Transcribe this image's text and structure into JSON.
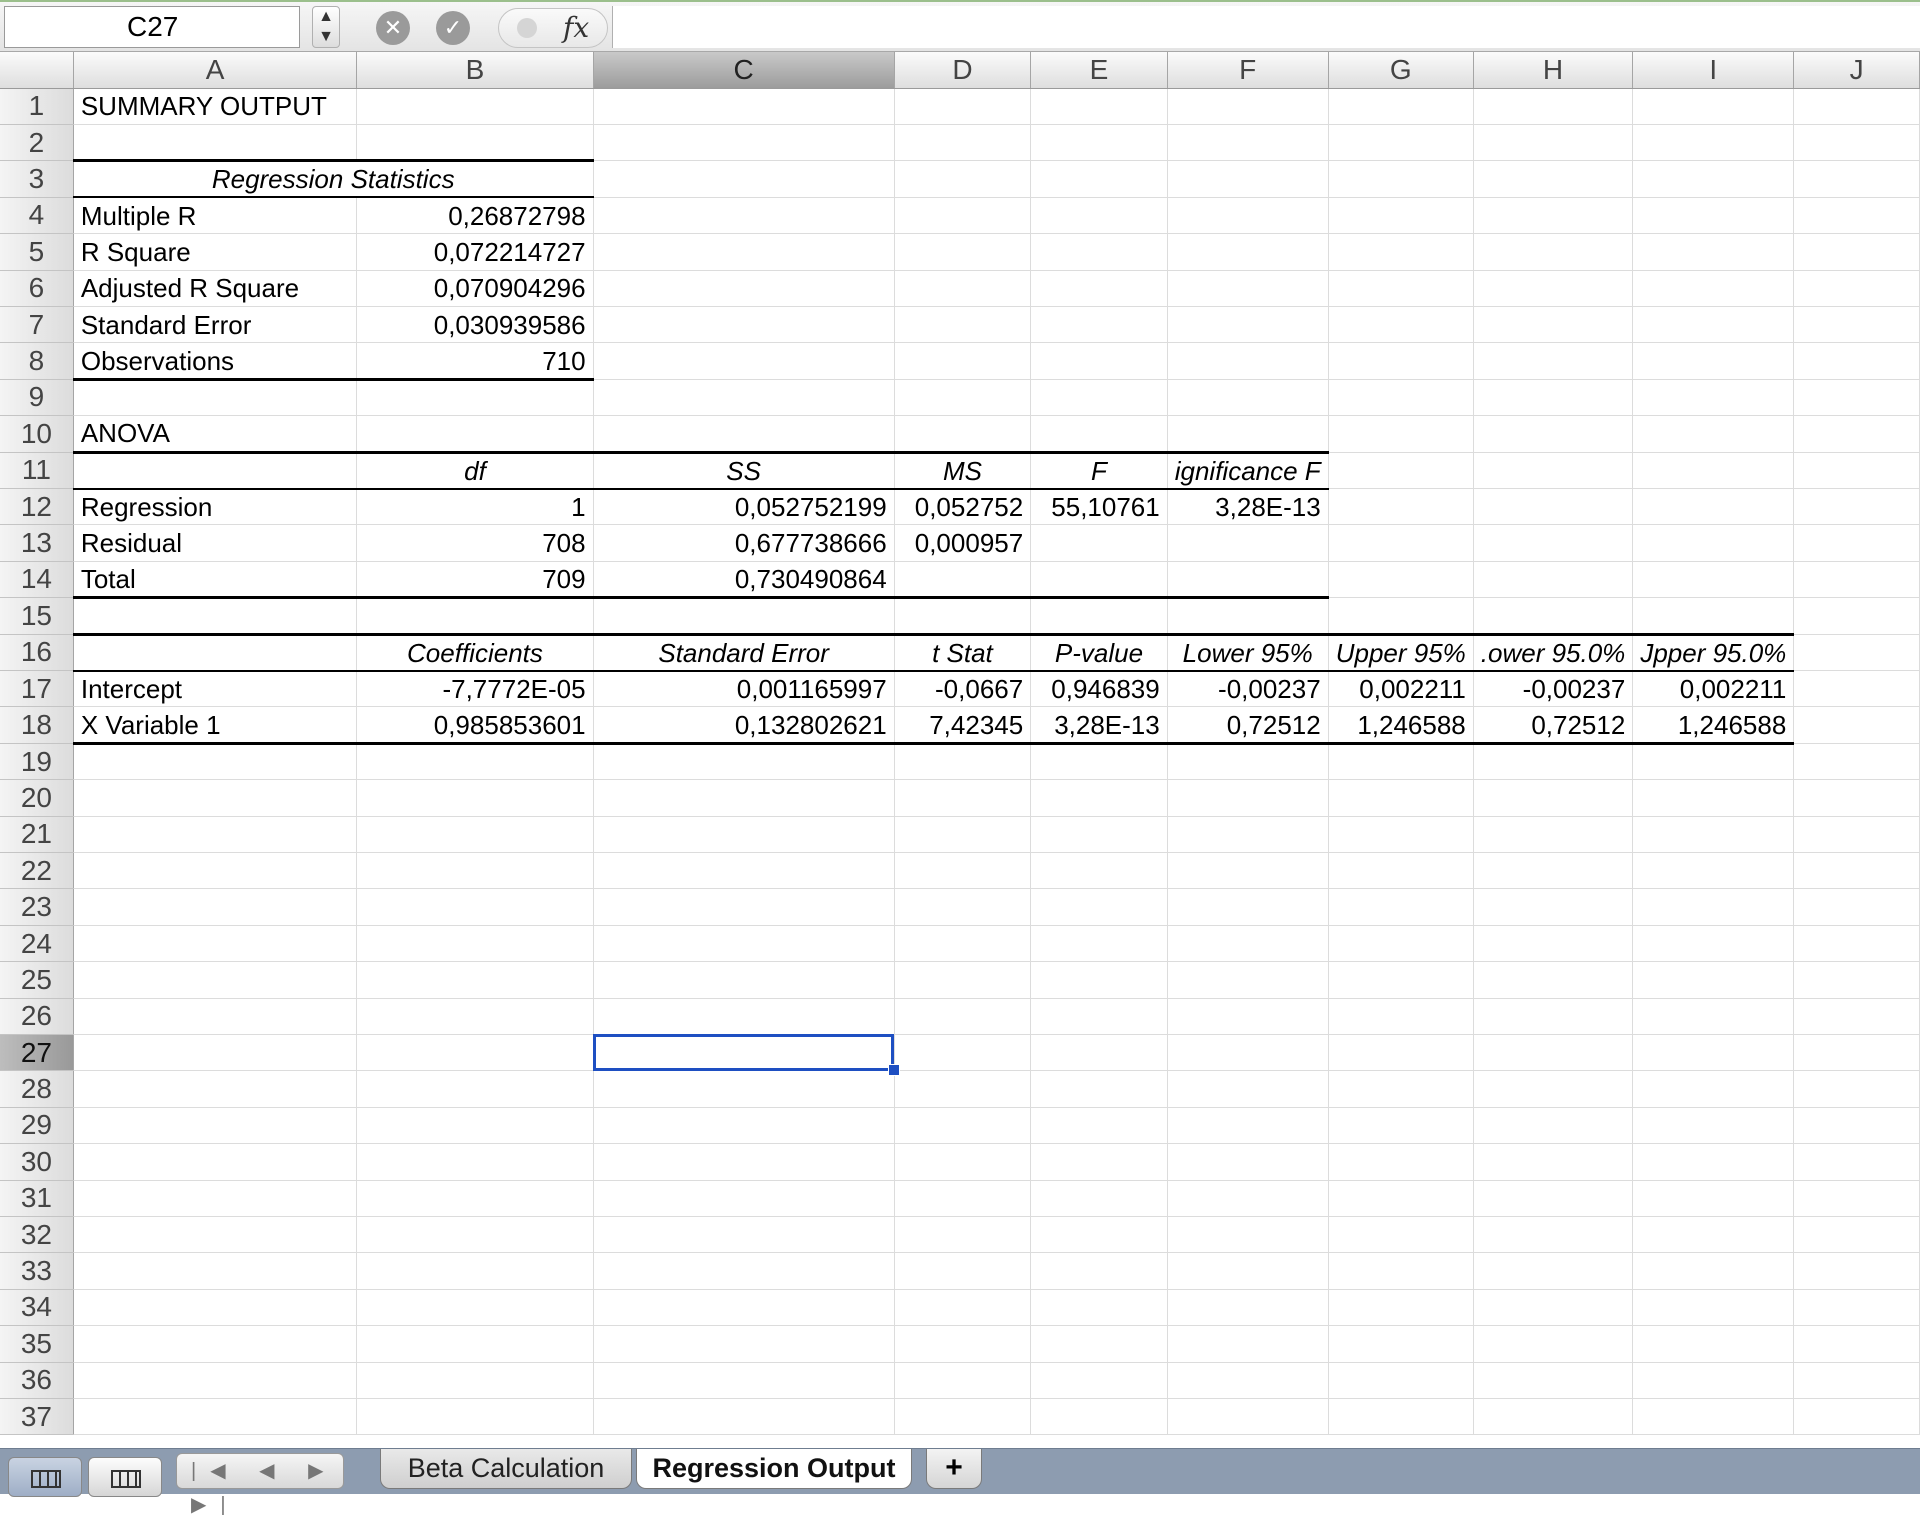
{
  "formula_bar": {
    "name_box": "C27",
    "stepper_icon": "updown-arrows-icon",
    "cancel_icon": "cancel-x-icon",
    "enter_icon": "checkmark-icon",
    "fx_label": "fx",
    "formula": ""
  },
  "columns": [
    "A",
    "B",
    "C",
    "D",
    "E",
    "F",
    "G",
    "H",
    "I",
    "J"
  ],
  "selected": {
    "cell": "C27",
    "column": "C",
    "row": "27"
  },
  "rows": [
    "1",
    "2",
    "3",
    "4",
    "5",
    "6",
    "7",
    "8",
    "9",
    "10",
    "11",
    "12",
    "13",
    "14",
    "15",
    "16",
    "17",
    "18",
    "19",
    "20",
    "21",
    "22",
    "23",
    "24",
    "25",
    "26",
    "27",
    "28",
    "29",
    "30",
    "31",
    "32",
    "33",
    "34",
    "35",
    "36",
    "37"
  ],
  "cells": {
    "A1": "SUMMARY OUTPUT",
    "A3": "Regression Statistics",
    "A4": "Multiple R",
    "B4": "0,26872798",
    "A5": "R Square",
    "B5": "0,072214727",
    "A6": "Adjusted R Square",
    "B6": "0,070904296",
    "A7": "Standard Error",
    "B7": "0,030939586",
    "A8": "Observations",
    "B8": "710",
    "A10": "ANOVA",
    "B11": "df",
    "C11": "SS",
    "D11": "MS",
    "E11": "F",
    "F11": "ignificance F",
    "A12": "Regression",
    "B12": "1",
    "C12": "0,052752199",
    "D12": "0,052752",
    "E12": "55,10761",
    "F12": "3,28E-13",
    "A13": "Residual",
    "B13": "708",
    "C13": "0,677738666",
    "D13": "0,000957",
    "A14": "Total",
    "B14": "709",
    "C14": "0,730490864",
    "B16": "Coefficients",
    "C16": "Standard Error",
    "D16": "t Stat",
    "E16": "P-value",
    "F16": "Lower 95%",
    "G16": "Upper 95%",
    "H16": ".ower 95.0%",
    "I16": "Jpper 95.0%",
    "A17": "Intercept",
    "B17": "-7,7772E-05",
    "C17": "0,001165997",
    "D17": "-0,0667",
    "E17": "0,946839",
    "F17": "-0,00237",
    "G17": "0,002211",
    "H17": "-0,00237",
    "I17": "0,002211",
    "A18": "X Variable 1",
    "B18": "0,985853601",
    "C18": "0,132802621",
    "D18": "7,42345",
    "E18": "3,28E-13",
    "F18": "0,72512",
    "G18": "1,246588",
    "H18": "0,72512",
    "I18": "1,246588"
  },
  "tab_bar": {
    "nav_arrows": "|◀ ◀ ▶ ▶|",
    "tabs": [
      "Beta Calculation",
      "Regression Output"
    ],
    "active_tab": "Regression Output",
    "add_tab": "+"
  }
}
